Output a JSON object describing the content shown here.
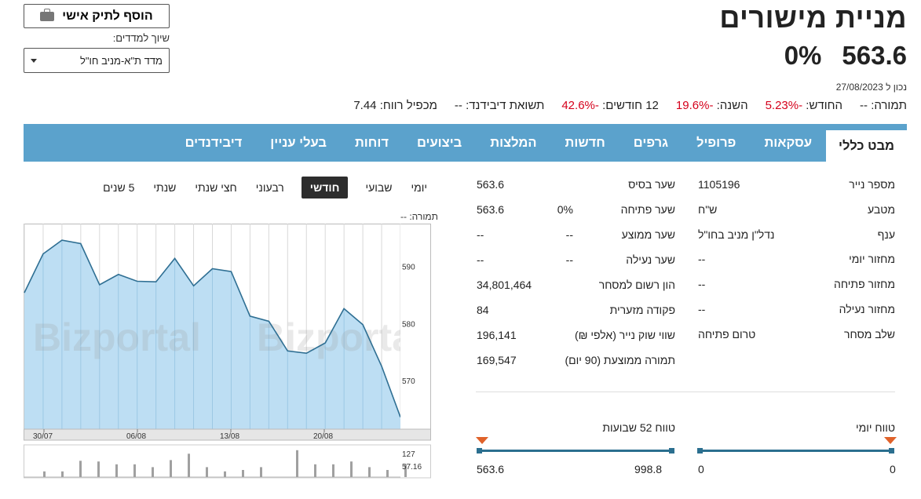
{
  "header": {
    "title": "מניית מישורים",
    "price": "563.6",
    "change": "0%",
    "as_of": "נכון ל 27/08/2023"
  },
  "stats": [
    {
      "label": "תמורה:",
      "value": "--",
      "neg": false
    },
    {
      "label": "החודש:",
      "value": "-5.23%",
      "neg": true
    },
    {
      "label": "השנה:",
      "value": "-19.6%",
      "neg": true
    },
    {
      "label": "12 חודשים:",
      "value": "-42.6%",
      "neg": true
    },
    {
      "label": "תשואת דיבידנד:",
      "value": "--",
      "neg": false
    },
    {
      "label": "מכפיל רווח:",
      "value": "7.44",
      "neg": false
    }
  ],
  "controls": {
    "add_portfolio": "הוסף לתיק אישי",
    "index_label": "שיוך למדדים:",
    "index_selected": "מדד ת\"א-מניב חו\"ל"
  },
  "tabs": [
    "מבט כללי",
    "עסקאות",
    "פרופיל",
    "גרפים",
    "חדשות",
    "המלצות",
    "ביצועים",
    "דוחות",
    "בעלי עניין",
    "דיבידנדים"
  ],
  "info_right": [
    {
      "label": "מספר נייר",
      "value": "1105196"
    },
    {
      "label": "מטבע",
      "value": "ש\"ח"
    },
    {
      "label": "ענף",
      "value": "נדל\"ן מניב בחו\"ל"
    },
    {
      "label": "מחזור יומי",
      "value": "--"
    },
    {
      "label": "מחזור פתיחה",
      "value": "--"
    },
    {
      "label": "מחזור נעילה",
      "value": "--"
    },
    {
      "label": "שלב מסחר",
      "value": "טרום פתיחה"
    }
  ],
  "info_mid": [
    {
      "label": "שער בסיס",
      "mid": "",
      "value": "563.6"
    },
    {
      "label": "שער פתיחה",
      "mid": "0%",
      "value": "563.6"
    },
    {
      "label": "שער ממוצע",
      "mid": "--",
      "value": "--"
    },
    {
      "label": "שער נעילה",
      "mid": "--",
      "value": "--"
    },
    {
      "label": "הון רשום למסחר",
      "mid": "",
      "value": "34,801,464"
    },
    {
      "label": "פקודה מזערית",
      "mid": "",
      "value": "84"
    },
    {
      "label": "שווי שוק נייר (אלפי ₪)",
      "mid": "",
      "value": "196,141"
    },
    {
      "label": "תמורה ממוצעת (90 יום)",
      "mid": "",
      "value": "169,547"
    }
  ],
  "ranges": {
    "daily_title": "טווח יומי",
    "daily_low": "0",
    "daily_high": "0",
    "week52_title": "טווח 52 שבועות",
    "week52_low": "563.6",
    "week52_high": "998.8"
  },
  "periods": [
    "יומי",
    "שבועי",
    "חודשי",
    "רבעוני",
    "חצי שנתי",
    "שנתי",
    "5 שנים"
  ],
  "active_period": "חודשי",
  "chart_data": {
    "type": "area",
    "volume_label": "תמורה: --",
    "watermark": "Bizportal",
    "y_ticks": [
      570,
      580,
      590
    ],
    "ylim": [
      561.5,
      597.5
    ],
    "x_tick_labels": [
      "30/07",
      "06/08",
      "13/08",
      "20/08"
    ],
    "values": [
      585.4,
      592.2,
      594.6,
      594.0,
      586.8,
      588.6,
      587.4,
      587.3,
      591.4,
      586.6,
      589.6,
      589.1,
      581.3,
      580.4,
      575.2,
      574.8,
      576.6,
      582.6,
      579.8,
      572.5,
      563.6
    ],
    "volume_ticks": [
      "127",
      "57.16"
    ],
    "volume": [
      0,
      8,
      8,
      23,
      22,
      18,
      18,
      14,
      24,
      33,
      14,
      8,
      10,
      14,
      0,
      38,
      18,
      18,
      22,
      14,
      10,
      18
    ]
  }
}
